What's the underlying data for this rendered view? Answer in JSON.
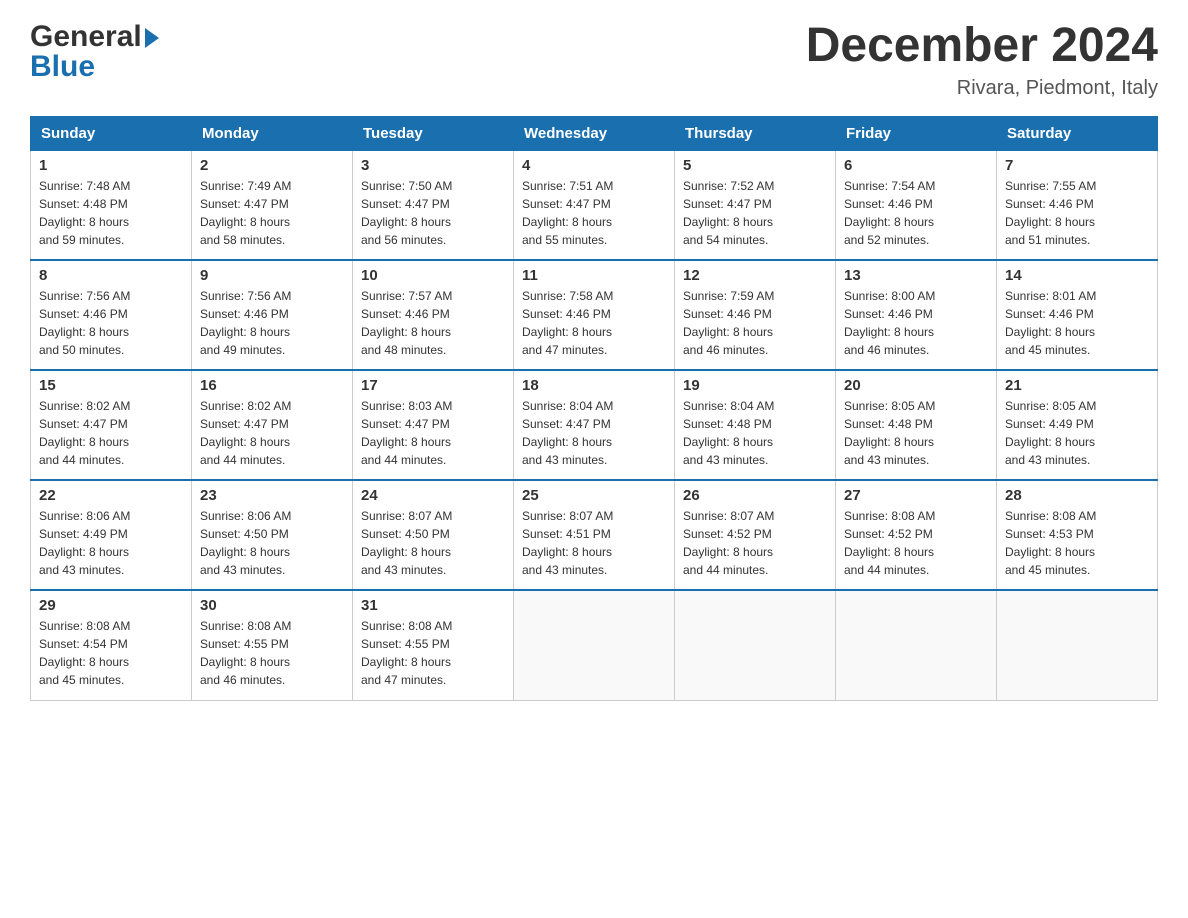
{
  "logo": {
    "general_text": "General",
    "blue_text": "Blue"
  },
  "header": {
    "title": "December 2024",
    "subtitle": "Rivara, Piedmont, Italy"
  },
  "days_of_week": [
    "Sunday",
    "Monday",
    "Tuesday",
    "Wednesday",
    "Thursday",
    "Friday",
    "Saturday"
  ],
  "weeks": [
    [
      {
        "day": "1",
        "sunrise": "7:48 AM",
        "sunset": "4:48 PM",
        "daylight_hours": "8",
        "daylight_minutes": "59"
      },
      {
        "day": "2",
        "sunrise": "7:49 AM",
        "sunset": "4:47 PM",
        "daylight_hours": "8",
        "daylight_minutes": "58"
      },
      {
        "day": "3",
        "sunrise": "7:50 AM",
        "sunset": "4:47 PM",
        "daylight_hours": "8",
        "daylight_minutes": "56"
      },
      {
        "day": "4",
        "sunrise": "7:51 AM",
        "sunset": "4:47 PM",
        "daylight_hours": "8",
        "daylight_minutes": "55"
      },
      {
        "day": "5",
        "sunrise": "7:52 AM",
        "sunset": "4:47 PM",
        "daylight_hours": "8",
        "daylight_minutes": "54"
      },
      {
        "day": "6",
        "sunrise": "7:54 AM",
        "sunset": "4:46 PM",
        "daylight_hours": "8",
        "daylight_minutes": "52"
      },
      {
        "day": "7",
        "sunrise": "7:55 AM",
        "sunset": "4:46 PM",
        "daylight_hours": "8",
        "daylight_minutes": "51"
      }
    ],
    [
      {
        "day": "8",
        "sunrise": "7:56 AM",
        "sunset": "4:46 PM",
        "daylight_hours": "8",
        "daylight_minutes": "50"
      },
      {
        "day": "9",
        "sunrise": "7:56 AM",
        "sunset": "4:46 PM",
        "daylight_hours": "8",
        "daylight_minutes": "49"
      },
      {
        "day": "10",
        "sunrise": "7:57 AM",
        "sunset": "4:46 PM",
        "daylight_hours": "8",
        "daylight_minutes": "48"
      },
      {
        "day": "11",
        "sunrise": "7:58 AM",
        "sunset": "4:46 PM",
        "daylight_hours": "8",
        "daylight_minutes": "47"
      },
      {
        "day": "12",
        "sunrise": "7:59 AM",
        "sunset": "4:46 PM",
        "daylight_hours": "8",
        "daylight_minutes": "46"
      },
      {
        "day": "13",
        "sunrise": "8:00 AM",
        "sunset": "4:46 PM",
        "daylight_hours": "8",
        "daylight_minutes": "46"
      },
      {
        "day": "14",
        "sunrise": "8:01 AM",
        "sunset": "4:46 PM",
        "daylight_hours": "8",
        "daylight_minutes": "45"
      }
    ],
    [
      {
        "day": "15",
        "sunrise": "8:02 AM",
        "sunset": "4:47 PM",
        "daylight_hours": "8",
        "daylight_minutes": "44"
      },
      {
        "day": "16",
        "sunrise": "8:02 AM",
        "sunset": "4:47 PM",
        "daylight_hours": "8",
        "daylight_minutes": "44"
      },
      {
        "day": "17",
        "sunrise": "8:03 AM",
        "sunset": "4:47 PM",
        "daylight_hours": "8",
        "daylight_minutes": "44"
      },
      {
        "day": "18",
        "sunrise": "8:04 AM",
        "sunset": "4:47 PM",
        "daylight_hours": "8",
        "daylight_minutes": "43"
      },
      {
        "day": "19",
        "sunrise": "8:04 AM",
        "sunset": "4:48 PM",
        "daylight_hours": "8",
        "daylight_minutes": "43"
      },
      {
        "day": "20",
        "sunrise": "8:05 AM",
        "sunset": "4:48 PM",
        "daylight_hours": "8",
        "daylight_minutes": "43"
      },
      {
        "day": "21",
        "sunrise": "8:05 AM",
        "sunset": "4:49 PM",
        "daylight_hours": "8",
        "daylight_minutes": "43"
      }
    ],
    [
      {
        "day": "22",
        "sunrise": "8:06 AM",
        "sunset": "4:49 PM",
        "daylight_hours": "8",
        "daylight_minutes": "43"
      },
      {
        "day": "23",
        "sunrise": "8:06 AM",
        "sunset": "4:50 PM",
        "daylight_hours": "8",
        "daylight_minutes": "43"
      },
      {
        "day": "24",
        "sunrise": "8:07 AM",
        "sunset": "4:50 PM",
        "daylight_hours": "8",
        "daylight_minutes": "43"
      },
      {
        "day": "25",
        "sunrise": "8:07 AM",
        "sunset": "4:51 PM",
        "daylight_hours": "8",
        "daylight_minutes": "43"
      },
      {
        "day": "26",
        "sunrise": "8:07 AM",
        "sunset": "4:52 PM",
        "daylight_hours": "8",
        "daylight_minutes": "44"
      },
      {
        "day": "27",
        "sunrise": "8:08 AM",
        "sunset": "4:52 PM",
        "daylight_hours": "8",
        "daylight_minutes": "44"
      },
      {
        "day": "28",
        "sunrise": "8:08 AM",
        "sunset": "4:53 PM",
        "daylight_hours": "8",
        "daylight_minutes": "45"
      }
    ],
    [
      {
        "day": "29",
        "sunrise": "8:08 AM",
        "sunset": "4:54 PM",
        "daylight_hours": "8",
        "daylight_minutes": "45"
      },
      {
        "day": "30",
        "sunrise": "8:08 AM",
        "sunset": "4:55 PM",
        "daylight_hours": "8",
        "daylight_minutes": "46"
      },
      {
        "day": "31",
        "sunrise": "8:08 AM",
        "sunset": "4:55 PM",
        "daylight_hours": "8",
        "daylight_minutes": "47"
      },
      null,
      null,
      null,
      null
    ]
  ],
  "labels": {
    "sunrise": "Sunrise:",
    "sunset": "Sunset:",
    "daylight": "Daylight:",
    "hours": "hours",
    "and": "and",
    "minutes": "minutes."
  }
}
